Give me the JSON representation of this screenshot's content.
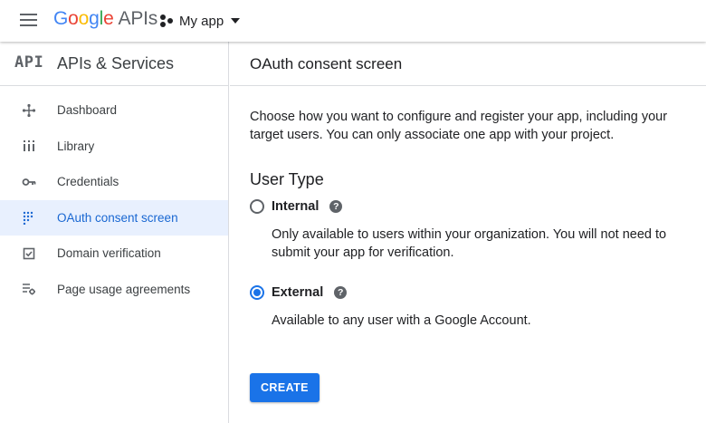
{
  "topbar": {
    "logo_letters": [
      {
        "ch": "G",
        "color": "#4285f4"
      },
      {
        "ch": "o",
        "color": "#ea4335"
      },
      {
        "ch": "o",
        "color": "#fbbc05"
      },
      {
        "ch": "g",
        "color": "#4285f4"
      },
      {
        "ch": "l",
        "color": "#34a853"
      },
      {
        "ch": "e",
        "color": "#ea4335"
      }
    ],
    "logo_suffix": "APIs",
    "project_name": "My app",
    "menu_icon": "hamburger-menu-icon",
    "project_icon": "project-hexagon-icon"
  },
  "sidebar": {
    "logo": "API",
    "title": "APIs & Services",
    "items": [
      {
        "label": "Dashboard",
        "icon": "dashboard-icon",
        "active": false
      },
      {
        "label": "Library",
        "icon": "library-icon",
        "active": false
      },
      {
        "label": "Credentials",
        "icon": "key-icon",
        "active": false
      },
      {
        "label": "OAuth consent screen",
        "icon": "consent-dots-icon",
        "active": true
      },
      {
        "label": "Domain verification",
        "icon": "checkbox-icon",
        "active": false
      },
      {
        "label": "Page usage agreements",
        "icon": "settings-list-icon",
        "active": false
      }
    ]
  },
  "main": {
    "title": "OAuth consent screen",
    "intro": "Choose how you want to configure and register your app, including your target users. You can only associate one app with your project.",
    "section_title": "User Type",
    "options": [
      {
        "label": "Internal",
        "description": "Only available to users within your organization. You will not need to submit your app for verification.",
        "selected": false
      },
      {
        "label": "External",
        "description": "Available to any user with a Google Account.",
        "selected": true
      }
    ],
    "help_glyph": "?",
    "create_label": "CREATE"
  },
  "colors": {
    "accent": "#1a73e8",
    "active_bg": "#e8f0fe",
    "active_text": "#1967d2"
  }
}
